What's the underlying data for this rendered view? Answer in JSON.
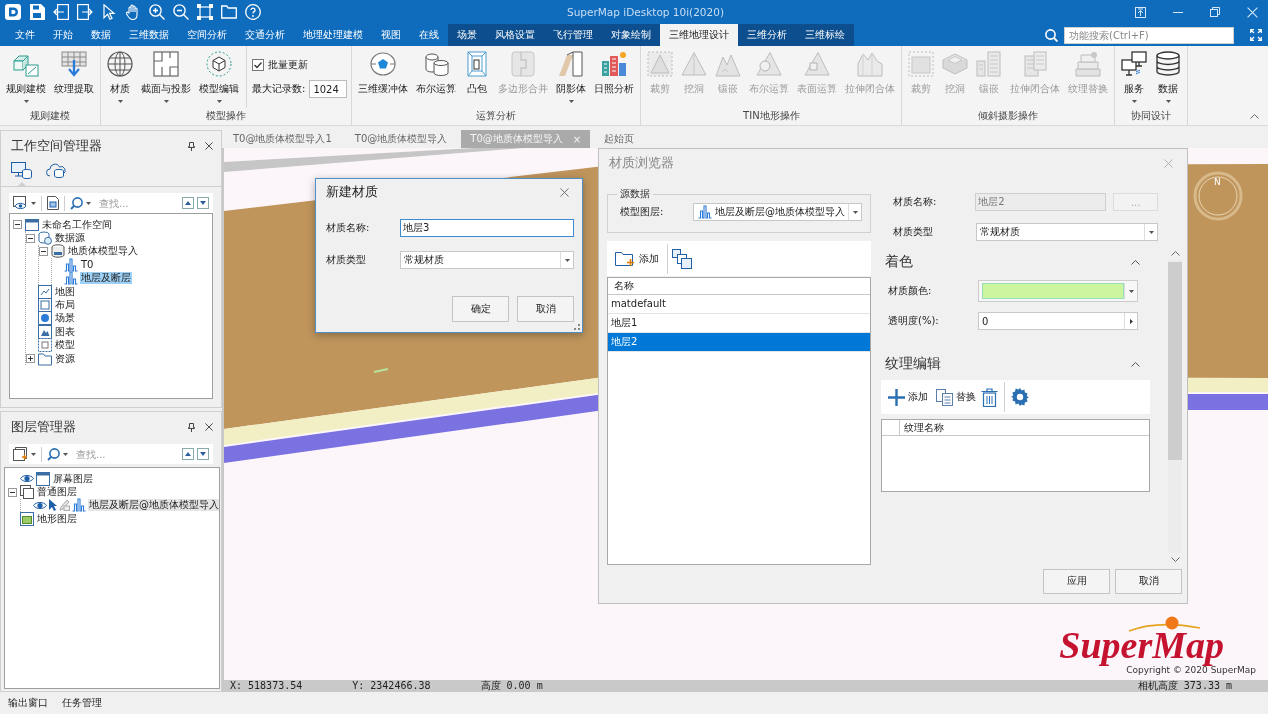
{
  "window": {
    "title": "SuperMap iDesktop 10i(2020)"
  },
  "menu_tabs": [
    {
      "label": "文件",
      "selected": false,
      "contextual": false
    },
    {
      "label": "开始",
      "selected": false,
      "contextual": false
    },
    {
      "label": "数据",
      "selected": false,
      "contextual": false
    },
    {
      "label": "三维数据",
      "selected": false,
      "contextual": false
    },
    {
      "label": "空间分析",
      "selected": false,
      "contextual": false
    },
    {
      "label": "交通分析",
      "selected": false,
      "contextual": false
    },
    {
      "label": "地理处理建模",
      "selected": false,
      "contextual": false
    },
    {
      "label": "视图",
      "selected": false,
      "contextual": false
    },
    {
      "label": "在线",
      "selected": false,
      "contextual": false
    },
    {
      "label": "场景",
      "selected": false,
      "contextual": true
    },
    {
      "label": "风格设置",
      "selected": false,
      "contextual": true
    },
    {
      "label": "飞行管理",
      "selected": false,
      "contextual": true
    },
    {
      "label": "对象绘制",
      "selected": false,
      "contextual": true
    },
    {
      "label": "三维地理设计",
      "selected": true,
      "contextual": true
    },
    {
      "label": "三维分析",
      "selected": false,
      "contextual": true
    },
    {
      "label": "三维标绘",
      "selected": false,
      "contextual": true
    }
  ],
  "search": {
    "placeholder": "功能搜索(Ctrl+F)"
  },
  "ribbon_groups": [
    {
      "title": "规则建模",
      "items": [
        {
          "kind": "large",
          "label": "规则建模",
          "dropdown": true,
          "disabled": false
        },
        {
          "kind": "large",
          "label": "纹理提取",
          "dropdown": false,
          "disabled": false
        }
      ]
    },
    {
      "title": "模型操作",
      "items": [
        {
          "kind": "large",
          "label": "材质",
          "dropdown": true,
          "disabled": false
        },
        {
          "kind": "large",
          "label": "截面与投影",
          "dropdown": true,
          "disabled": false
        },
        {
          "kind": "large",
          "label": "模型编辑",
          "dropdown": true,
          "disabled": false
        },
        {
          "kind": "checkbox",
          "label": "批量更新",
          "checked": true
        },
        {
          "kind": "number",
          "label": "最大记录数:",
          "value": "1024"
        }
      ]
    },
    {
      "title": "运算分析",
      "items": [
        {
          "kind": "large",
          "label": "三维缓冲体",
          "dropdown": false,
          "disabled": false
        },
        {
          "kind": "large",
          "label": "布尔运算",
          "dropdown": false,
          "disabled": false
        },
        {
          "kind": "large",
          "label": "凸包",
          "dropdown": false,
          "disabled": false
        },
        {
          "kind": "large",
          "label": "多边形合并",
          "dropdown": false,
          "disabled": true
        },
        {
          "kind": "large",
          "label": "阴影体",
          "dropdown": true,
          "disabled": false
        },
        {
          "kind": "large",
          "label": "日照分析",
          "dropdown": false,
          "disabled": false
        }
      ]
    },
    {
      "title": "TIN地形操作",
      "items": [
        {
          "kind": "large",
          "label": "裁剪",
          "dropdown": false,
          "disabled": true
        },
        {
          "kind": "large",
          "label": "挖洞",
          "dropdown": false,
          "disabled": true
        },
        {
          "kind": "large",
          "label": "镶嵌",
          "dropdown": false,
          "disabled": true
        },
        {
          "kind": "large",
          "label": "布尔运算",
          "dropdown": false,
          "disabled": true
        },
        {
          "kind": "large",
          "label": "表面运算",
          "dropdown": false,
          "disabled": true
        },
        {
          "kind": "large",
          "label": "拉伸闭合体",
          "dropdown": false,
          "disabled": true
        }
      ]
    },
    {
      "title": "倾斜摄影操作",
      "items": [
        {
          "kind": "large",
          "label": "裁剪",
          "dropdown": false,
          "disabled": true
        },
        {
          "kind": "large",
          "label": "挖洞",
          "dropdown": false,
          "disabled": true
        },
        {
          "kind": "large",
          "label": "镶嵌",
          "dropdown": false,
          "disabled": true
        },
        {
          "kind": "large",
          "label": "拉伸闭合体",
          "dropdown": false,
          "disabled": true
        },
        {
          "kind": "large",
          "label": "纹理替换",
          "dropdown": false,
          "disabled": true
        }
      ]
    },
    {
      "title": "协同设计",
      "items": [
        {
          "kind": "large",
          "label": "服务",
          "dropdown": true,
          "disabled": false
        },
        {
          "kind": "large",
          "label": "数据",
          "dropdown": true,
          "disabled": false
        }
      ]
    }
  ],
  "workspace_manager": {
    "title": "工作空间管理器",
    "view_tabs": [
      {
        "selected": true
      },
      {
        "selected": false
      }
    ],
    "search": {
      "placeholder": "查找..."
    },
    "tree": [
      {
        "label": "未命名工作空间",
        "kind": "workspace",
        "expanded": true,
        "selected": false,
        "children": [
          {
            "label": "数据源",
            "kind": "datasources",
            "expanded": true,
            "selected": false,
            "children": [
              {
                "label": "地质体模型导入",
                "kind": "datasource",
                "expanded": true,
                "selected": false,
                "children": [
                  {
                    "label": "T0",
                    "kind": "dataset",
                    "selected": false
                  },
                  {
                    "label": "地层及断层",
                    "kind": "dataset",
                    "selected": true
                  }
                ]
              }
            ]
          },
          {
            "label": "地图",
            "kind": "maps",
            "selected": false
          },
          {
            "label": "布局",
            "kind": "layouts",
            "selected": false
          },
          {
            "label": "场景",
            "kind": "scenes",
            "selected": false
          },
          {
            "label": "图表",
            "kind": "charts",
            "selected": false
          },
          {
            "label": "模型",
            "kind": "models",
            "selected": false
          },
          {
            "label": "资源",
            "kind": "resources",
            "expanded": false,
            "selected": false
          }
        ]
      }
    ]
  },
  "layer_manager": {
    "title": "图层管理器",
    "search": {
      "placeholder": "查找..."
    },
    "tree": [
      {
        "label": "屏幕图层",
        "kind": "screen",
        "visible": true,
        "selected": false
      },
      {
        "label": "普通图层",
        "kind": "group",
        "expanded": true,
        "selected": false,
        "children": [
          {
            "label": "地层及断层@地质体模型导入",
            "kind": "model",
            "visible": true,
            "selectable": true,
            "editable": false,
            "selected": true
          }
        ]
      },
      {
        "label": "地形图层",
        "kind": "terrain",
        "selected": false
      }
    ]
  },
  "doc_tabs": [
    {
      "label": "T0@地质体模型导入1",
      "selected": false
    },
    {
      "label": "T0@地质体模型导入",
      "selected": false
    },
    {
      "label": "T0@地质体模型导入",
      "selected": true,
      "close": "×"
    },
    {
      "label": "起始页",
      "selected": false
    }
  ],
  "scene": {
    "compass_label": "N",
    "logo": "SuperMap",
    "copyright": "Copyright © 2020 SuperMap",
    "status": [
      "X: 518373.54",
      "Y: 2342466.38",
      "高度 0.00 m"
    ],
    "status_right": "相机高度 373.33 m"
  },
  "new_material_dialog": {
    "title": "新建材质",
    "active": true,
    "fields": [
      {
        "kind": "text",
        "label": "材质名称:",
        "value": "地层3",
        "focused": true
      },
      {
        "kind": "select",
        "label": "材质类型",
        "value": "常规材质",
        "focused": false
      }
    ],
    "buttons": [
      {
        "label": "确定"
      },
      {
        "label": "取消"
      }
    ]
  },
  "material_browser": {
    "title": "材质浏览器",
    "active": false,
    "source": {
      "legend": "源数据",
      "layer_label": "模型图层:",
      "layer_value": "地层及断层@地质体模型导入"
    },
    "toolbar": {
      "add_label": "添加"
    },
    "list": {
      "column": "名称",
      "rows": [
        {
          "name": "matdefault",
          "selected": false
        },
        {
          "name": "地层1",
          "selected": false
        },
        {
          "name": "地层2",
          "selected": true
        }
      ]
    },
    "name_label": "材质名称:",
    "name_value": "地层2",
    "browse_button": "...",
    "type_label": "材质类型",
    "type_value": "常规材质",
    "color_section": {
      "title": "着色",
      "expanded": true,
      "color_label": "材质颜色:",
      "color": "#ccf5a0",
      "opacity_label": "透明度(%):",
      "opacity_value": "0"
    },
    "texture_section": {
      "title": "纹理编辑",
      "expanded": true,
      "add_label": "添加",
      "replace_label": "替换",
      "column": "纹理名称"
    },
    "buttons": [
      {
        "label": "应用"
      },
      {
        "label": "取消"
      }
    ]
  },
  "bottom_tabs": [
    {
      "label": "输出窗口"
    },
    {
      "label": "任务管理"
    }
  ]
}
